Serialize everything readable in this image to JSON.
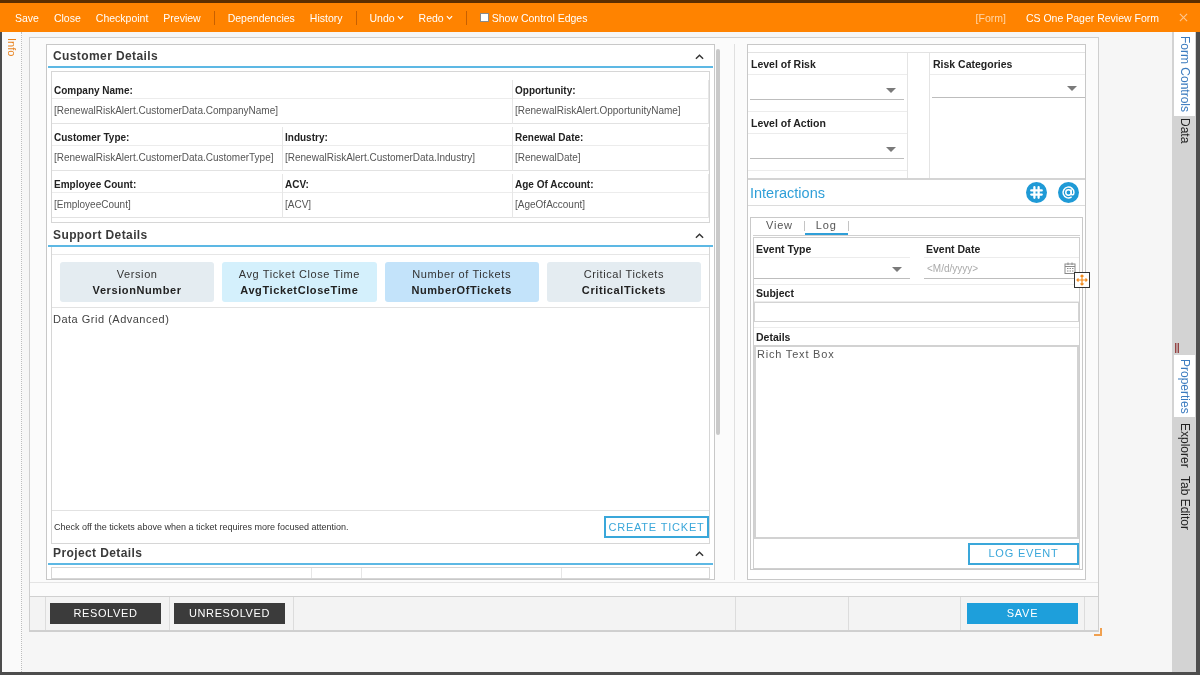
{
  "toolbar": {
    "groups": [
      [
        {
          "label": "Save",
          "kind": "button"
        },
        {
          "label": "Close",
          "kind": "button"
        },
        {
          "label": "Checkpoint",
          "kind": "button"
        },
        {
          "label": "Preview",
          "kind": "button"
        }
      ],
      [
        {
          "label": "Dependencies",
          "kind": "button"
        },
        {
          "label": "History",
          "kind": "button"
        }
      ],
      [
        {
          "label": "Undo",
          "kind": "dropdown"
        },
        {
          "label": "Redo",
          "kind": "dropdown"
        }
      ]
    ],
    "show_control_edges": {
      "label": "Show Control Edges",
      "checked": false
    },
    "context": "[Form]",
    "title": "CS One Pager Review Form"
  },
  "left_tab": {
    "label": "Info"
  },
  "sections": [
    {
      "kind": "fields",
      "title": "Customer Details",
      "expanded": true,
      "fields": [
        {
          "label": "Company Name:",
          "value": "[RenewalRiskAlert.CustomerData.CompanyName]",
          "wide": true
        },
        {
          "label": "Opportunity:",
          "value": "[RenewalRiskAlert.OpportunityName]",
          "wide": false
        },
        {
          "label": "Customer Type:",
          "value": "[RenewalRiskAlert.CustomerData.CustomerType]",
          "wide": false
        },
        {
          "label": "Industry:",
          "value": "[RenewalRiskAlert.CustomerData.Industry]",
          "wide": false
        },
        {
          "label": "Renewal Date:",
          "value": "[RenewalDate]",
          "wide": false
        },
        {
          "label": "Employee Count:",
          "value": "[EmployeeCount]",
          "wide": false
        },
        {
          "label": "ACV:",
          "value": "[ACV]",
          "wide": false
        },
        {
          "label": "Age Of Account:",
          "value": "[AgeOfAccount]",
          "wide": false
        }
      ]
    },
    {
      "kind": "stats",
      "title": "Support Details",
      "expanded": true,
      "cards": [
        {
          "label": "Version",
          "value": "VersionNumber",
          "color": "#e4ecf1"
        },
        {
          "label": "Avg Ticket Close Time",
          "value": "AvgTicketCloseTime",
          "color": "#d4f0fc"
        },
        {
          "label": "Number of Tickets",
          "value": "NumberOfTickets",
          "color": "#c3e3fa"
        },
        {
          "label": "Critical Tickets",
          "value": "CriticalTickets",
          "color": "#e4ecf1"
        }
      ],
      "grid_label": "Data Grid (Advanced)",
      "note": "Check off the tickets above when a ticket requires more focused attention.",
      "button": "CREATE TICKET"
    },
    {
      "kind": "empty",
      "title": "Project Details",
      "expanded": true
    }
  ],
  "risk": {
    "levels": [
      {
        "label": "Level of Risk"
      },
      {
        "label": "Level of Action"
      }
    ],
    "categories": {
      "label": "Risk Categories"
    }
  },
  "interactions": {
    "title": "Interactions",
    "tabs": [
      {
        "label": "View",
        "selected": false
      },
      {
        "label": "Log",
        "selected": true
      }
    ],
    "event_type": {
      "label": "Event Type"
    },
    "event_date": {
      "label": "Event Date",
      "placeholder": "<M/d/yyyy>"
    },
    "subject": {
      "label": "Subject"
    },
    "details": {
      "label": "Details",
      "content": "Rich Text Box"
    },
    "button": "LOG EVENT"
  },
  "footer_buttons": [
    {
      "label": "RESOLVED",
      "kind": "dark"
    },
    {
      "label": "UNRESOLVED",
      "kind": "dark"
    },
    {
      "label": "SAVE",
      "kind": "primary"
    }
  ],
  "side_tabs": [
    [
      {
        "label": "Form Controls",
        "selected": true
      },
      {
        "label": "Data",
        "selected": false
      }
    ],
    [
      {
        "label": "Properties",
        "selected": true
      },
      {
        "label": "Explorer",
        "selected": false
      },
      {
        "label": "Tab Editor",
        "selected": false
      }
    ]
  ]
}
